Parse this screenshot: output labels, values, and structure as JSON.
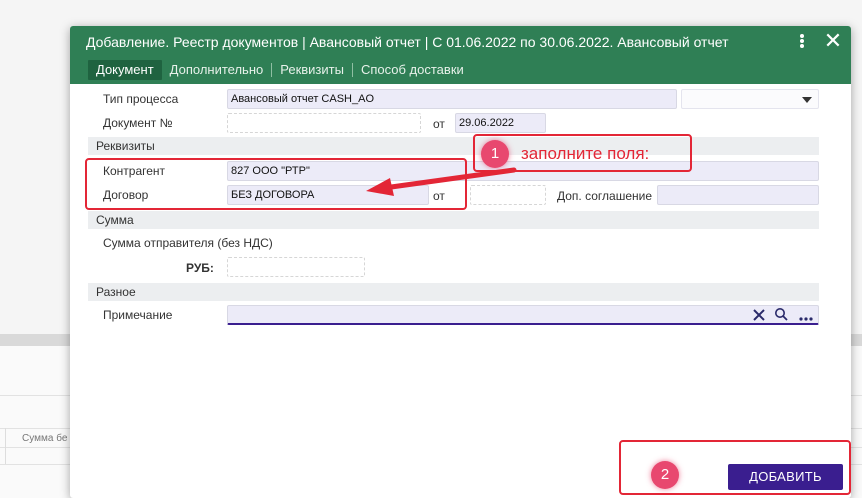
{
  "dialog": {
    "title": "Добавление. Реестр документов | Авансовый отчет | С 01.06.2022 по 30.06.2022. Авансовый отчет",
    "close_glyph": "✕",
    "tabs": [
      {
        "label": "Документ",
        "active": true
      },
      {
        "label": "Дополнительно"
      },
      {
        "label": "Реквизиты"
      },
      {
        "label": "Способ доставки"
      }
    ]
  },
  "form": {
    "process_type": {
      "label": "Тип процесса",
      "value": "Авансовый отчет CASH_AO"
    },
    "document_no": {
      "label": "Документ №",
      "value": "",
      "date_label": "от",
      "date_value": "29.06.2022"
    },
    "requisites": {
      "section": "Реквизиты",
      "counterparty": {
        "label": "Контрагент",
        "value": "827 ООО \"РТР\""
      },
      "contract": {
        "label": "Договор",
        "value": "БЕЗ ДОГОВОРА",
        "date_label": "от",
        "date_value": ""
      },
      "addendum": {
        "label": "Доп. соглашение",
        "value": ""
      }
    },
    "amount": {
      "section": "Сумма",
      "sender_label": "Сумма отправителя (без НДС)",
      "currency_label": "РУБ:",
      "value": ""
    },
    "misc": {
      "section": "Разное",
      "note_label": "Примечание",
      "note_value": ""
    }
  },
  "buttons": {
    "add": "ДОБАВИТЬ"
  },
  "annotations": {
    "step1_number": "1",
    "step1_text": "заполните поля:",
    "step2_number": "2"
  },
  "background": {
    "column_header": "Сумма бе"
  },
  "colors": {
    "header": "#2f7f55",
    "active_tab": "#1f6340",
    "primary_button": "#3a1e8f",
    "highlight": "#e32636",
    "badge": "#e8486f"
  }
}
